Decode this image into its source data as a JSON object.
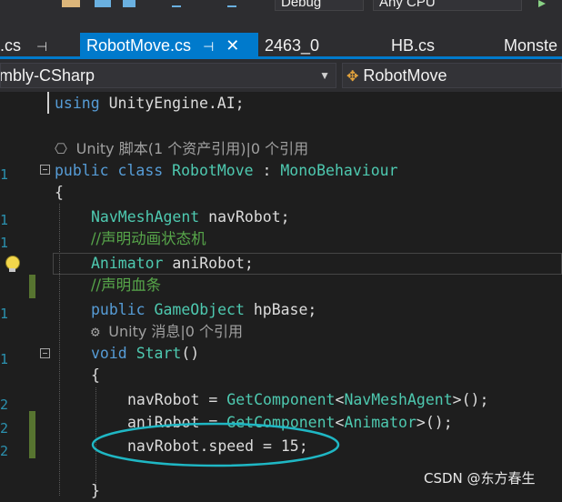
{
  "toolbar": {
    "config_combo": "Debug",
    "platform_combo": "Any CPU"
  },
  "tabs": [
    {
      "label": ".cs"
    },
    {
      "label": "RobotMove.cs"
    },
    {
      "label": "2463_0"
    },
    {
      "label": "HB.cs"
    },
    {
      "label": "Monste"
    }
  ],
  "navbar": {
    "project": "mbly-CSharp",
    "type": "RobotMove"
  },
  "code": {
    "l1_kw": "using",
    "l1_rest": " UnityEngine.AI;",
    "l2_lens": "Unity 脚本(1 个资产引用)|0 个引用",
    "l3_kw1": "public",
    "l3_kw2": "class",
    "l3_name": "RobotMove",
    "l3_colon": " : ",
    "l3_base": "MonoBehaviour",
    "l4": "{",
    "l5_type": "NavMeshAgent",
    "l5_rest": " navRobot;",
    "l6_comment": "//声明动画状态机",
    "l7_type": "Animator",
    "l7_rest": " aniRobot;",
    "l8_comment": "//声明血条",
    "l9_kw": "public",
    "l9_type": "GameObject",
    "l9_rest": " hpBase;",
    "l10_lens": "Unity 消息|0 个引用",
    "l11_kw": "void",
    "l11_name": "Start",
    "l11_rest": "()",
    "l12": "{",
    "l13_a": "navRobot = ",
    "l13_fn": "GetComponent",
    "l13_lt": "<",
    "l13_type": "NavMeshAgent",
    "l13_end": ">();",
    "l14_a": "aniRobot = ",
    "l14_fn": "GetComponent",
    "l14_lt": "<",
    "l14_type": "Animator",
    "l14_end": ">();",
    "l15": "navRobot.speed = 15;",
    "l16": "}"
  },
  "watermark": "CSDN @东方春生",
  "colors": {
    "keyword": "#569cd6",
    "type": "#4ec9b0",
    "comment": "#57a64a",
    "accent": "#007acc",
    "annotation_ellipse": "#1fb7c4"
  }
}
